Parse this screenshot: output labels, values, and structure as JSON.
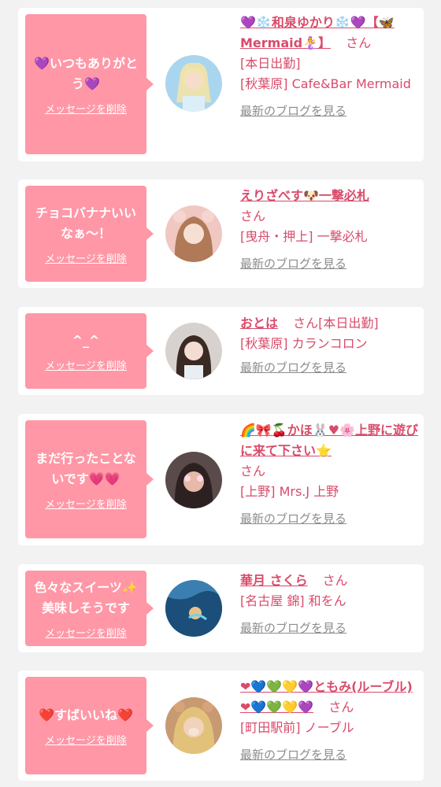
{
  "messages": [
    {
      "bubble_text": "💜いつもありがとう💜",
      "delete_label": "メッセージを削除",
      "girl_name": "💜❄️和泉ゆかり❄️💜【🦋Mermaid🧜‍♀️】",
      "honorific": "さん",
      "detail_1": "[本日出勤]",
      "detail_2": "[秋葉原] Cafe&Bar Mermaid",
      "blog_link": "最新のブログを見る",
      "avatar_color": "#a9d6ee"
    },
    {
      "bubble_text": "チョコバナナいいなぁ〜！",
      "delete_label": "メッセージを削除",
      "girl_name": "えりざべす🐶一撃必札",
      "honorific": "さん",
      "detail_1": "[曳舟・押上] 一撃必札",
      "detail_2": "",
      "blog_link": "最新のブログを見る",
      "avatar_color": "#f1c7c2"
    },
    {
      "bubble_text": "^_^",
      "delete_label": "メッセージを削除",
      "girl_name": "おとは",
      "honorific": "さん",
      "detail_1": "[本日出勤]",
      "detail_2": "[秋葉原] カランコロン",
      "blog_link": "最新のブログを見る",
      "avatar_color": "#d8d2cf"
    },
    {
      "bubble_text": "まだ行ったことないです💗💗",
      "delete_label": "メッセージを削除",
      "girl_name": "🌈🎀🍒かほ🐰♥🌸上野に遊びに来て下さい⭐",
      "honorific": "さん",
      "detail_1": "[上野] Mrs.J 上野",
      "detail_2": "",
      "blog_link": "最新のブログを見る",
      "avatar_color": "#5a4b4a"
    },
    {
      "bubble_text": "色々なスイーツ✨美味しそうです",
      "delete_label": "メッセージを削除",
      "girl_name": "華月 さくら",
      "honorific": "さん",
      "detail_1": "[名古屋 錦] 和をん",
      "detail_2": "",
      "blog_link": "最新のブログを見る",
      "avatar_color": "#3a7fb0"
    },
    {
      "bubble_text": "❤️すばいいね❤️",
      "delete_label": "メッセージを削除",
      "girl_name": "❤💙💚💛💜ともみ(ルーブル)❤💙💚💛💜",
      "honorific": "さん",
      "detail_1": "[町田駅前] ノーブル",
      "detail_2": "",
      "blog_link": "最新のブログを見る",
      "avatar_color": "#c79a72"
    }
  ]
}
